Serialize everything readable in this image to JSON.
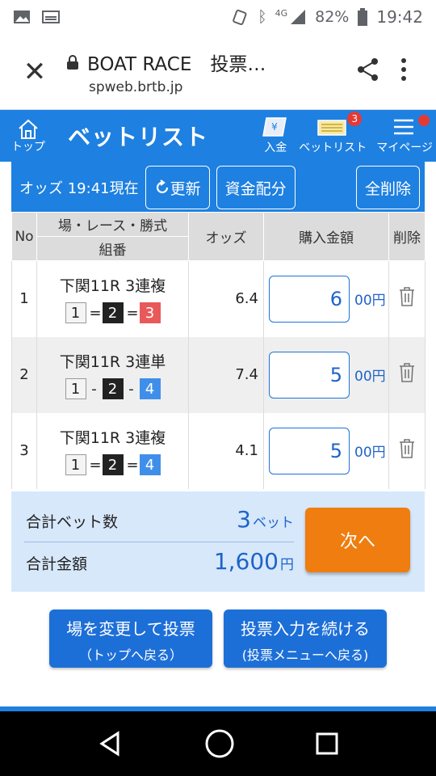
{
  "status_bar": {
    "battery": "82%",
    "time": "19:42",
    "network": "4G"
  },
  "browser": {
    "title": "BOAT RACE　投票…",
    "host": "spweb.brtb.jp"
  },
  "app_bar": {
    "home_label": "トップ",
    "title": "ベットリスト",
    "deposit_label": "入金",
    "betlist_label": "ベットリスト",
    "betlist_badge": "3",
    "mypage_label": "マイページ"
  },
  "odds_bar": {
    "time_text": "オッズ 19:41現在",
    "refresh_label": "更新",
    "allocate_label": "資金配分",
    "delete_all_label": "全削除"
  },
  "table": {
    "headers": {
      "no": "No",
      "race": "場・レース・勝式",
      "combo": "組番",
      "odds": "オッズ",
      "amount": "購入金額",
      "delete": "削除"
    },
    "unit": "00円",
    "rows": [
      {
        "no": "1",
        "race": "下関11R 3連複",
        "c1": "1",
        "s1": "=",
        "c2": "2",
        "s2": "=",
        "c3": "3",
        "odds": "6.4",
        "amount": "6"
      },
      {
        "no": "2",
        "race": "下関11R 3連単",
        "c1": "1",
        "s1": "-",
        "c2": "2",
        "s2": "-",
        "c3": "4",
        "odds": "7.4",
        "amount": "5"
      },
      {
        "no": "3",
        "race": "下関11R 3連複",
        "c1": "1",
        "s1": "=",
        "c2": "2",
        "s2": "=",
        "c3": "4",
        "odds": "4.1",
        "amount": "5"
      }
    ]
  },
  "summary": {
    "bet_count_label": "合計ベット数",
    "bet_count": "3",
    "bet_unit": "ベット",
    "total_label": "合計金額",
    "total": "1,600",
    "total_unit": "円",
    "next_label": "次へ"
  },
  "bottom_buttons": {
    "change_main": "場を変更して投票",
    "change_sub": "（トップへ戻る）",
    "continue_main": "投票入力を続ける",
    "continue_sub": "(投票メニューへ戻る)"
  },
  "colors": {
    "primary": "#1e80e0",
    "button_blue": "#1d6fd8",
    "next_orange": "#ef7d0f",
    "summary_bg": "#d7e8fb",
    "boat3_red": "#e85a5a",
    "boat4_blue": "#3f8fea"
  }
}
